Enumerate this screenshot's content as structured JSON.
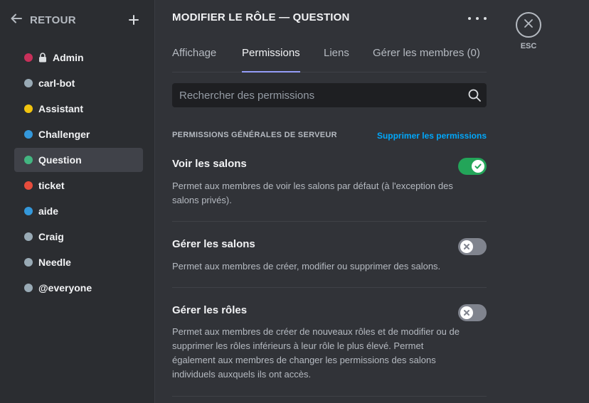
{
  "sidebar": {
    "back_label": "RETOUR",
    "roles": [
      {
        "name": "Admin",
        "color": "#c8305a",
        "locked": true
      },
      {
        "name": "carl-bot",
        "color": "#99aab5"
      },
      {
        "name": "Assistant",
        "color": "#f1c40f"
      },
      {
        "name": "Challenger",
        "color": "#3498db"
      },
      {
        "name": "Question",
        "color": "#43b581",
        "selected": true
      },
      {
        "name": "ticket",
        "color": "#e74c3c"
      },
      {
        "name": "aide",
        "color": "#3498db"
      },
      {
        "name": "Craig",
        "color": "#99aab5"
      },
      {
        "name": "Needle",
        "color": "#99aab5"
      },
      {
        "name": "@everyone",
        "color": "#99aab5"
      }
    ]
  },
  "header": {
    "title": "MODIFIER LE RÔLE — QUESTION"
  },
  "tabs": [
    {
      "label": "Affichage"
    },
    {
      "label": "Permissions",
      "active": true
    },
    {
      "label": "Liens"
    },
    {
      "label": "Gérer les membres (0)"
    }
  ],
  "search": {
    "placeholder": "Rechercher des permissions"
  },
  "section": {
    "title": "PERMISSIONS GÉNÉRALES DE SERVEUR",
    "clear_label": "Supprimer les permissions"
  },
  "permissions": [
    {
      "name": "Voir les salons",
      "description": "Permet aux membres de voir les salons par défaut (à l'exception des salons privés).",
      "enabled": true
    },
    {
      "name": "Gérer les salons",
      "description": "Permet aux membres de créer, modifier ou supprimer des salons.",
      "enabled": false
    },
    {
      "name": "Gérer les rôles",
      "description": "Permet aux membres de créer de nouveaux rôles et de modifier ou de supprimer les rôles inférieurs à leur rôle le plus élevé. Permet également aux membres de changer les permissions des salons individuels auxquels ils ont accès.",
      "enabled": false
    }
  ],
  "close": {
    "label": "ESC"
  },
  "colors": {
    "toggle_on": "#23a559",
    "toggle_off": "#80848e",
    "link": "#00a8fc",
    "tab_underline": "#949cf7"
  }
}
